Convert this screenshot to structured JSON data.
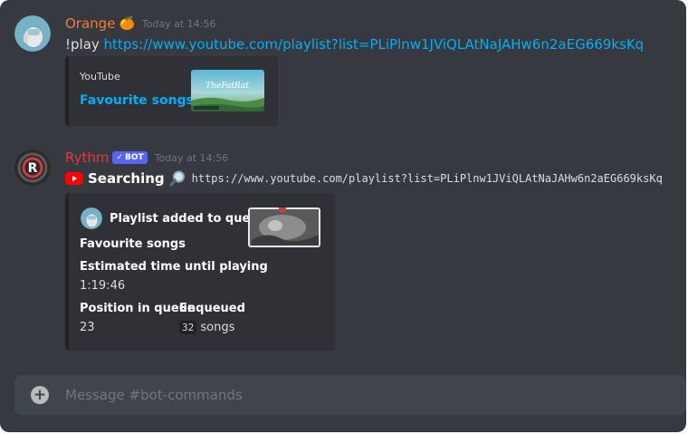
{
  "messages": [
    {
      "username": "Orange",
      "username_emoji": "🍊",
      "username_color": "#f47b36",
      "timestamp": "Today at 14:56",
      "content_prefix": "!play ",
      "content_link": "https://www.youtube.com/playlist?list=PLiPlnw1JViQLAtNaJAHw6n2aEG669ksKq",
      "embed": {
        "provider": "YouTube",
        "title": "Favourite songs",
        "thumbnail_icon": "playlist-thumbnail"
      }
    },
    {
      "username": "Rythm",
      "username_color": "#e03b3b",
      "bot_tag": "BOT",
      "timestamp": "Today at 14:56",
      "youtube_icon": "youtube-icon",
      "searching_label": "Searching",
      "search_icon": "magnifier-icon",
      "search_url": "https://www.youtube.com/playlist?list=PLiPlnw1JViQLAtNaJAHw6n2aEG669ksKq",
      "embed": {
        "author": "Playlist added to queue",
        "description": "Favourite songs",
        "fields": {
          "eta_name": "Estimated time until playing",
          "eta_value": "1:19:46",
          "position_name": "Position in queue",
          "position_value": "23",
          "enqueued_name": "Enqueued",
          "enqueued_count": "32",
          "enqueued_suffix": "songs"
        }
      }
    }
  ],
  "composer": {
    "placeholder": "Message #bot-commands",
    "add_icon": "plus-circle-icon"
  },
  "colors": {
    "background": "#36393f",
    "embed_bg": "#2f3136",
    "link": "#00aff4",
    "bot_tag": "#5865f2"
  }
}
